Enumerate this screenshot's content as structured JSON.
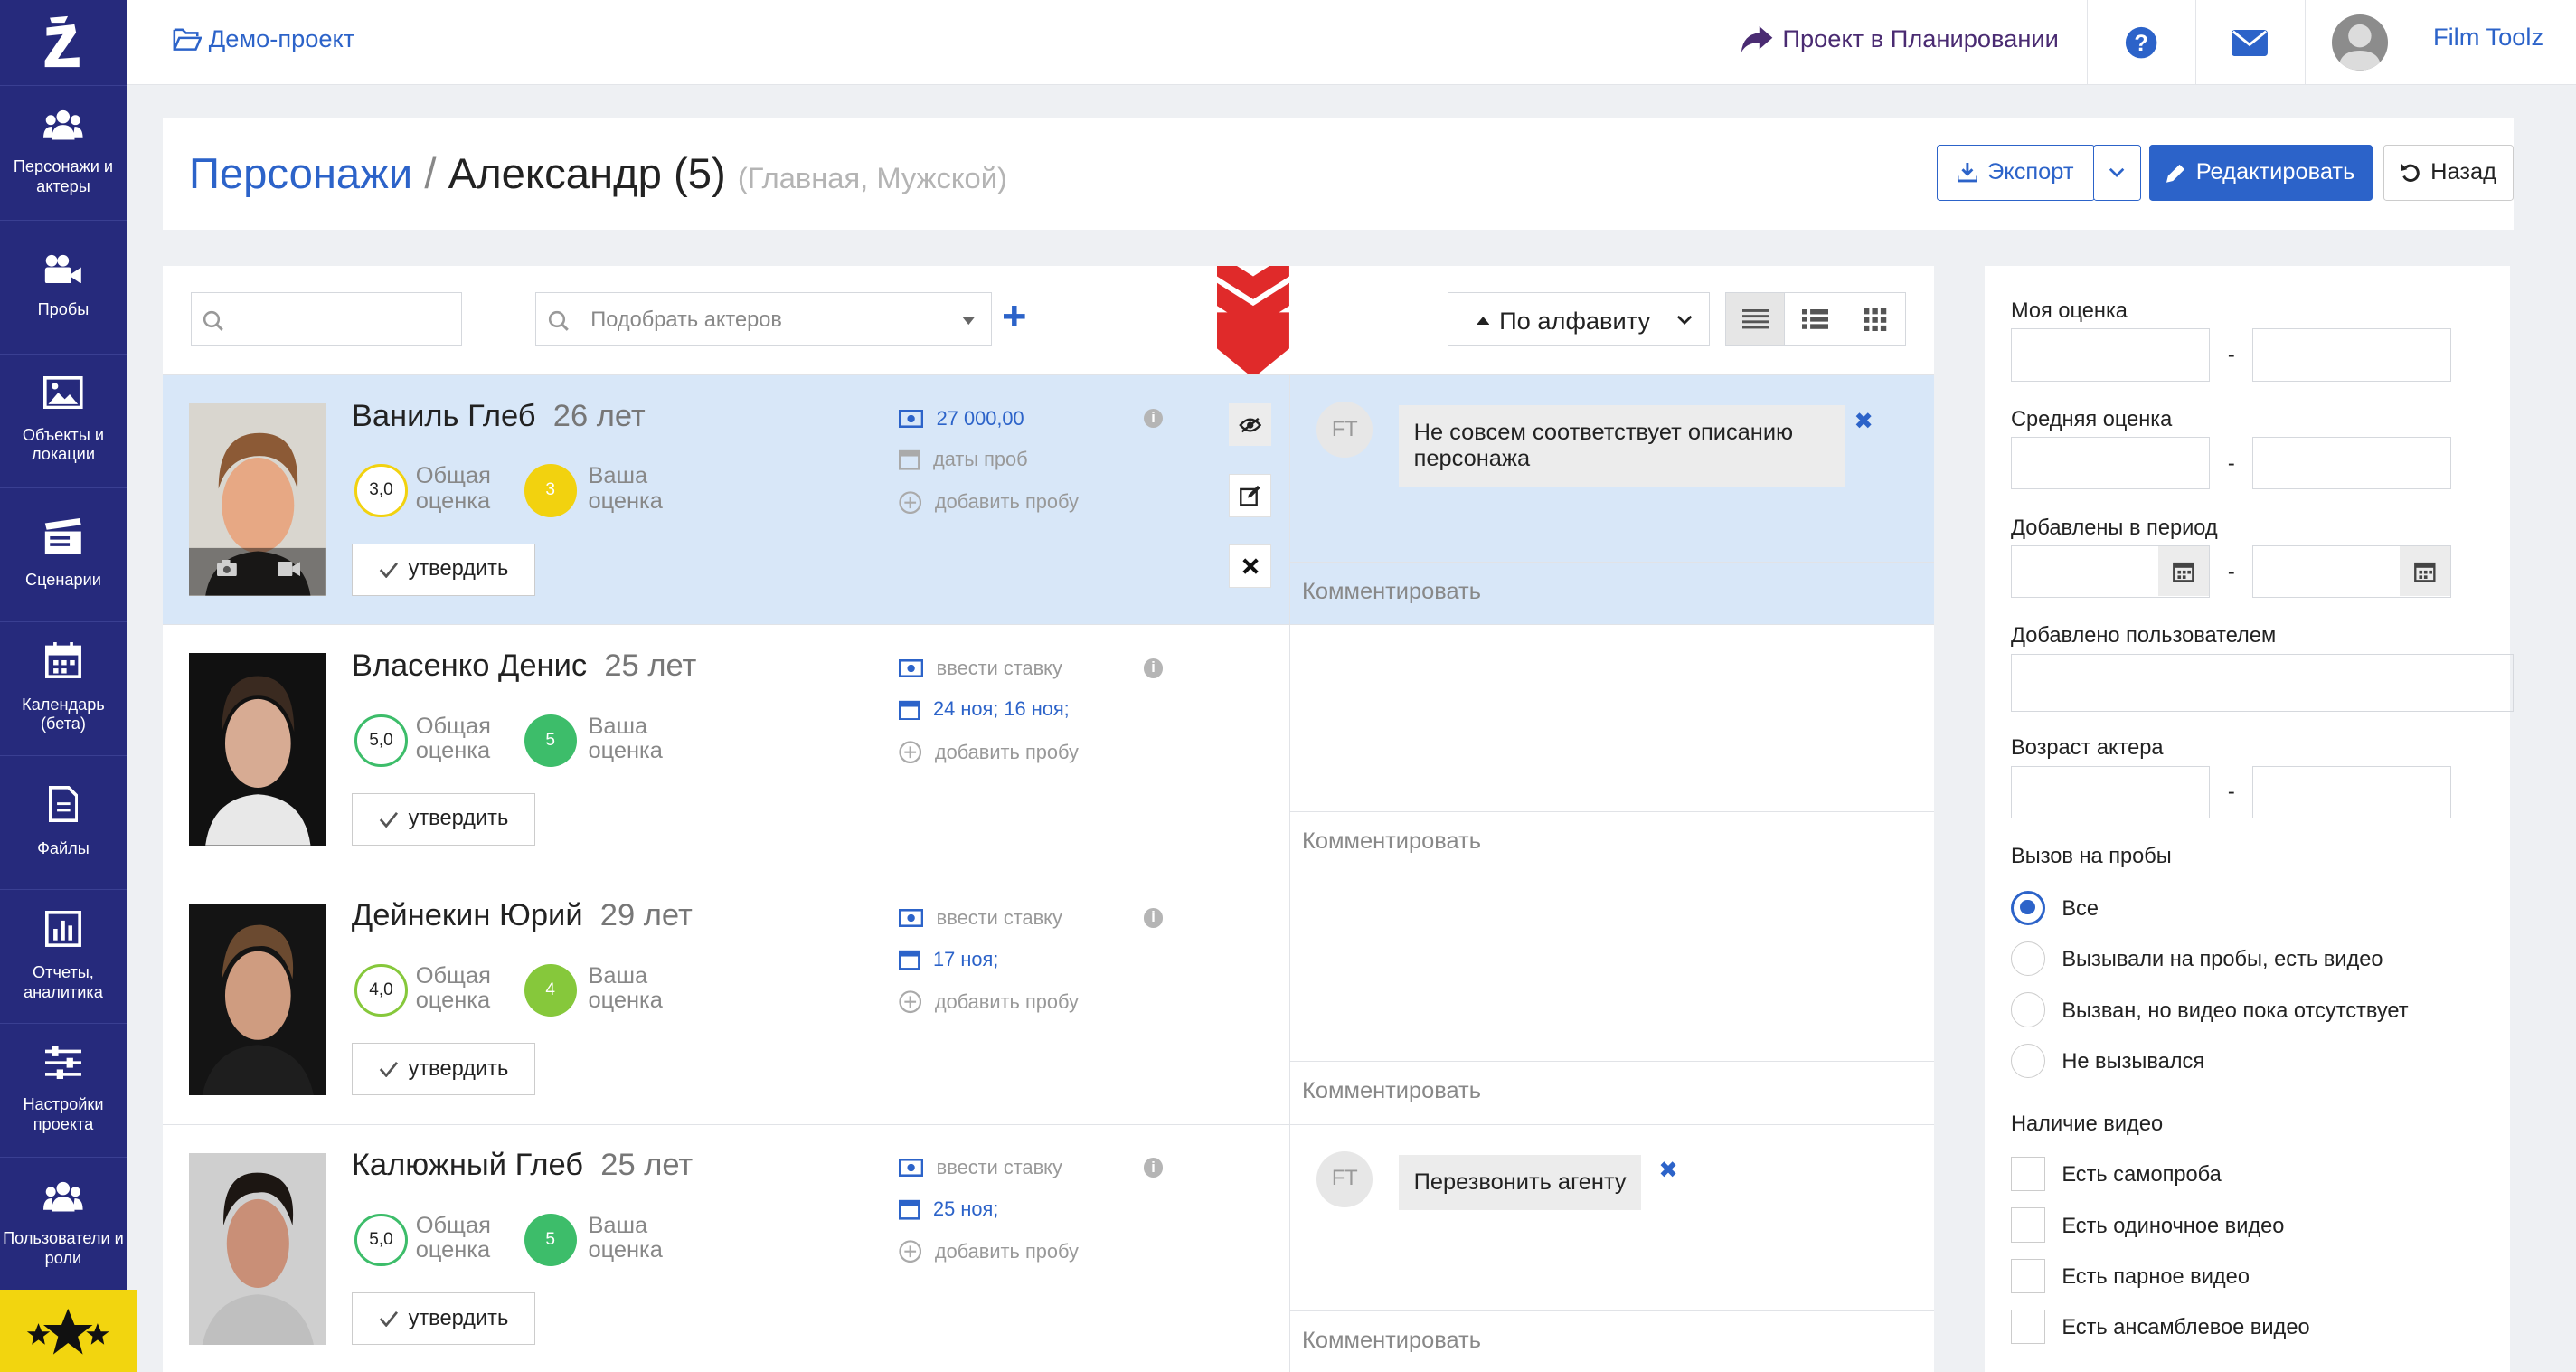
{
  "sidebar": {
    "items": [
      {
        "label": "Персонажи и актеры"
      },
      {
        "label": "Пробы"
      },
      {
        "label": "Объекты и локации"
      },
      {
        "label": "Сценарии"
      },
      {
        "label": "Календарь (бета)"
      },
      {
        "label": "Файлы"
      },
      {
        "label": "Отчеты, аналитика"
      },
      {
        "label": "Настройки проекта"
      },
      {
        "label": "Пользователи и роли"
      }
    ]
  },
  "topbar": {
    "project": "Демо-проект",
    "planning": "Проект в Планировании",
    "user": "Film Toolz"
  },
  "header": {
    "section": "Персонажи",
    "separator": "/",
    "character": "Александр (5)",
    "subtitle": "(Главная, Мужской)",
    "export": "Экспорт",
    "edit": "Редактировать",
    "back": "Назад"
  },
  "toolbar": {
    "search_value": "",
    "pick_actors": "Подобрать актеров",
    "sort": "По алфавиту"
  },
  "actors": [
    {
      "name": "Ваниль Глеб",
      "age": "26 лет",
      "overall_score": "3,0",
      "overall_label": "Общая оценка",
      "my_score": "3",
      "my_label": "Ваша оценка",
      "approve": "утвердить",
      "rate": "27 000,00",
      "dates": "даты проб",
      "add_trial": "добавить пробу",
      "comment_author": "FT",
      "comment": "Не совсем соответствует описанию персонажа",
      "comment_input": "Комментировать",
      "selected": true
    },
    {
      "name": "Власенко Денис",
      "age": "25 лет",
      "overall_score": "5,0",
      "overall_label": "Общая оценка",
      "my_score": "5",
      "my_label": "Ваша оценка",
      "approve": "утвердить",
      "rate": "ввести ставку",
      "dates": "24 ноя; 16 ноя;",
      "add_trial": "добавить пробу",
      "comment_author": "",
      "comment": "",
      "comment_input": "Комментировать",
      "selected": false
    },
    {
      "name": "Дейнекин Юрий",
      "age": "29 лет",
      "overall_score": "4,0",
      "overall_label": "Общая оценка",
      "my_score": "4",
      "my_label": "Ваша оценка",
      "approve": "утвердить",
      "rate": "ввести ставку",
      "dates": "17 ноя;",
      "add_trial": "добавить пробу",
      "comment_author": "",
      "comment": "",
      "comment_input": "Комментировать",
      "selected": false
    },
    {
      "name": "Калюжный Глеб",
      "age": "25 лет",
      "overall_score": "5,0",
      "overall_label": "Общая оценка",
      "my_score": "5",
      "my_label": "Ваша оценка",
      "approve": "утвердить",
      "rate": "ввести ставку",
      "dates": "25 ноя;",
      "add_trial": "добавить пробу",
      "comment_author": "FT",
      "comment": "Перезвонить агенту",
      "comment_input": "Комментировать",
      "selected": false
    }
  ],
  "filters": {
    "my_rating": "Моя оценка",
    "avg_rating": "Средняя оценка",
    "added_period": "Добавлены в период",
    "added_by": "Добавлено пользователем",
    "actor_age": "Возраст актера",
    "dash": "-",
    "trials_call": "Вызов на пробы",
    "trial_options": [
      "Все",
      "Вызывали на пробы, есть видео",
      "Вызван, но видео пока отсутствует",
      "Не вызывался"
    ],
    "selected_trial_option": "Все",
    "video": "Наличие видео",
    "video_options": [
      "Есть самопроба",
      "Есть одиночное видео",
      "Есть парное видео",
      "Есть ансамблевое видео"
    ]
  },
  "colors": {
    "sidebar": "#262a7c",
    "accent": "#2c63c9",
    "selected_row": "#d8e7f8",
    "score_yellow": "#f2d20f",
    "score_green": "#3dbd6a",
    "score_lime": "#86c83b",
    "arrow": "#e02a2a"
  }
}
